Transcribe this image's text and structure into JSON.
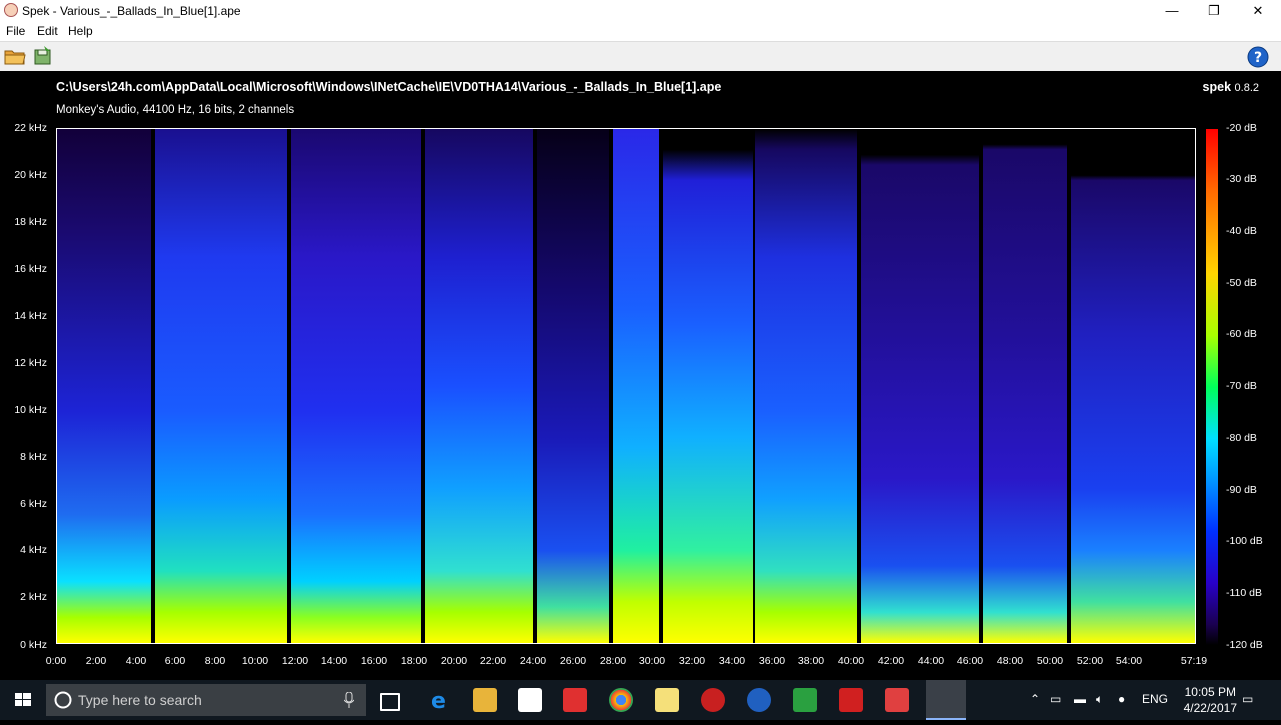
{
  "window": {
    "title": "Spek - Various_-_Ballads_In_Blue[1].ape",
    "minimize_label": "—",
    "maximize_label": "❐",
    "close_label": "✕"
  },
  "menu": [
    "File",
    "Edit",
    "Help"
  ],
  "toolbar": {
    "open_icon": "open-folder-icon",
    "save_icon": "save-icon",
    "help_icon": "help-icon"
  },
  "header": {
    "file_path": "C:\\Users\\24h.com\\AppData\\Local\\Microsoft\\Windows\\INetCache\\IE\\VD0THA14\\Various_-_Ballads_In_Blue[1].ape",
    "app_name": "spek",
    "app_version": "0.8.2",
    "file_info": "Monkey's Audio, 44100 Hz, 16 bits, 2 channels"
  },
  "frequency_labels": [
    "22 kHz",
    "20 kHz",
    "18 kHz",
    "16 kHz",
    "14 kHz",
    "12 kHz",
    "10 kHz",
    "8 kHz",
    "6 kHz",
    "4 kHz",
    "2 kHz",
    "0 kHz"
  ],
  "time_labels": [
    "0:00",
    "2:00",
    "4:00",
    "6:00",
    "8:00",
    "10:00",
    "12:00",
    "14:00",
    "16:00",
    "18:00",
    "20:00",
    "22:00",
    "24:00",
    "26:00",
    "28:00",
    "30:00",
    "32:00",
    "34:00",
    "36:00",
    "38:00",
    "40:00",
    "42:00",
    "44:00",
    "46:00",
    "48:00",
    "50:00",
    "52:00",
    "54:00",
    "57:19"
  ],
  "db_labels": [
    "-20 dB",
    "-30 dB",
    "-40 dB",
    "-50 dB",
    "-60 dB",
    "-70 dB",
    "-80 dB",
    "-90 dB",
    "-100 dB",
    "-110 dB",
    "-120 dB"
  ],
  "taskbar": {
    "search_placeholder": "Type here to search",
    "language": "ENG",
    "time": "10:05 PM",
    "date": "4/22/2017"
  },
  "colors": {
    "spectrogram_bg": "#000000",
    "accent_blue": "#0a2bff"
  }
}
